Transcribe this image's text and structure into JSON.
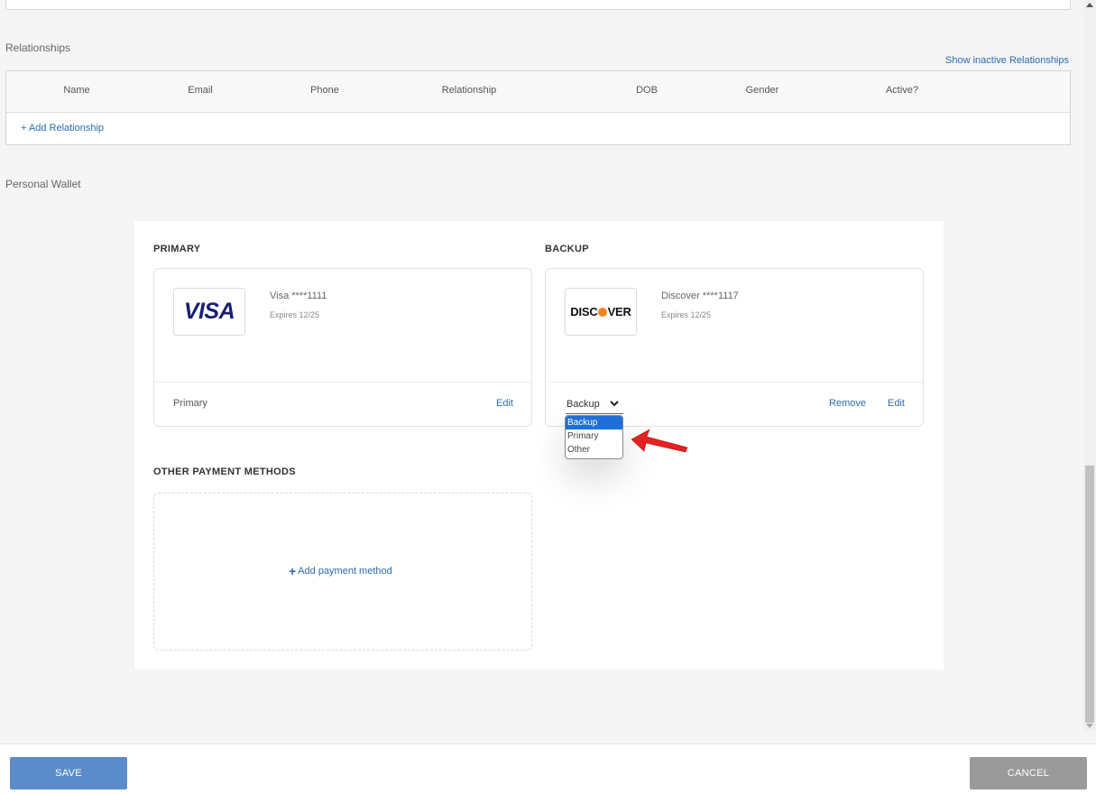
{
  "relationships": {
    "title": "Relationships",
    "show_inactive": "Show inactive Relationships",
    "columns": [
      "Name",
      "Email",
      "Phone",
      "Relationship",
      "DOB",
      "Gender",
      "Active?"
    ],
    "add_label": "+ Add Relationship"
  },
  "wallet": {
    "title": "Personal Wallet",
    "primary_heading": "PRIMARY",
    "backup_heading": "BACKUP",
    "other_heading": "OTHER PAYMENT METHODS",
    "primary_card": {
      "brand": "VISA",
      "name": "Visa ****1111",
      "expires": "Expires 12/25",
      "role_label": "Primary",
      "edit": "Edit"
    },
    "backup_card": {
      "brand_pre": "DISC",
      "brand_post": "VER",
      "name": "Discover ****1117",
      "expires": "Expires 12/25",
      "selected_role": "Backup",
      "remove": "Remove",
      "edit": "Edit"
    },
    "role_options": [
      "Backup",
      "Primary",
      "Other"
    ],
    "add_payment": "Add payment method"
  },
  "footer": {
    "save": "SAVE",
    "cancel": "CANCEL"
  },
  "colors": {
    "link": "#2a6bb0",
    "save_button": "#5a8ccc",
    "cancel_button": "#9a9a9a",
    "dropdown_selected": "#1e6fd9",
    "annotation_arrow": "#e52222"
  }
}
